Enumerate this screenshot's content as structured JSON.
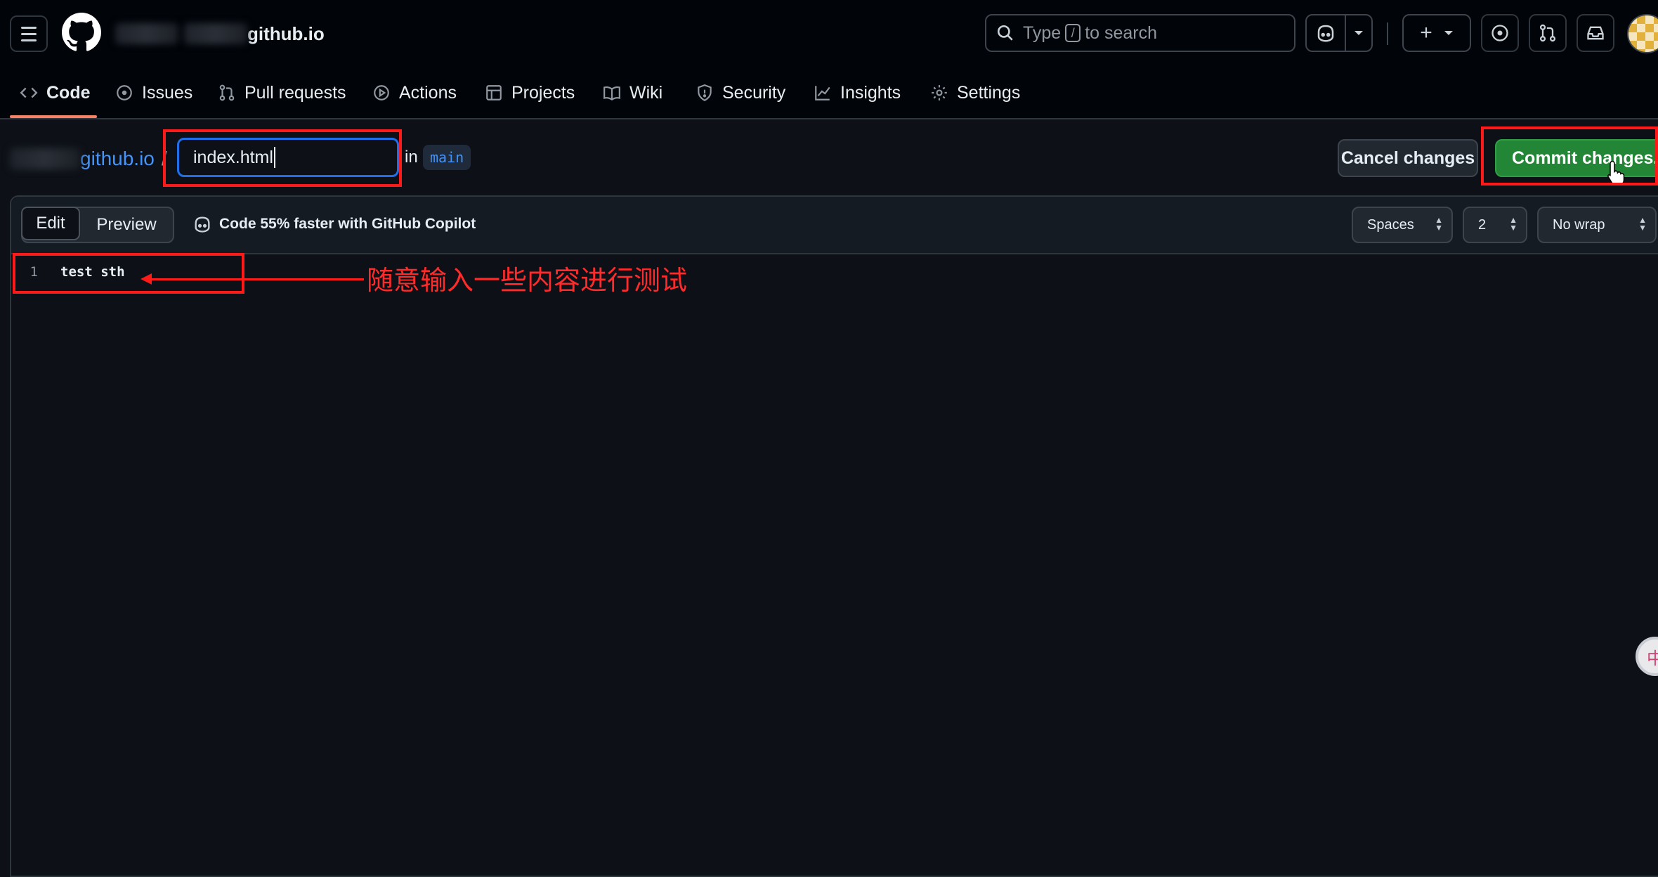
{
  "header": {
    "repo_suffix": "github.io",
    "search_prefix": "Type",
    "search_key": "/",
    "search_suffix": "to search"
  },
  "nav": {
    "tabs": [
      {
        "label": "Code",
        "icon": "code-icon",
        "active": true
      },
      {
        "label": "Issues",
        "icon": "issue-icon"
      },
      {
        "label": "Pull requests",
        "icon": "pull-request-icon"
      },
      {
        "label": "Actions",
        "icon": "play-icon"
      },
      {
        "label": "Projects",
        "icon": "table-icon"
      },
      {
        "label": "Wiki",
        "icon": "book-icon"
      },
      {
        "label": "Security",
        "icon": "shield-icon"
      },
      {
        "label": "Insights",
        "icon": "graph-icon"
      },
      {
        "label": "Settings",
        "icon": "gear-icon"
      }
    ]
  },
  "filebar": {
    "repo_link": "github.io",
    "separator": "/",
    "filename": "index.html",
    "in_label": "in",
    "branch": "main",
    "cancel_label": "Cancel changes",
    "commit_label": "Commit changes..."
  },
  "editor": {
    "edit_tab": "Edit",
    "preview_tab": "Preview",
    "copilot_hint": "Code 55% faster with GitHub Copilot",
    "indent_mode": "Spaces",
    "indent_size": "2",
    "wrap_mode": "No wrap",
    "lines": [
      {
        "number": "1",
        "text": "test sth"
      }
    ]
  },
  "annotation": {
    "text": "随意输入一些内容进行测试",
    "color": "#ff1a1a"
  },
  "colors": {
    "accent_blue": "#4493f8",
    "commit_green": "#238636",
    "tab_underline": "#f78166",
    "background": "#0d1117"
  }
}
